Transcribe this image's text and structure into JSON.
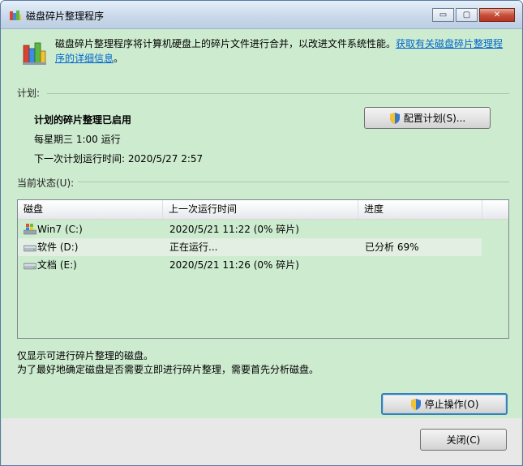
{
  "window": {
    "title": "磁盘碎片整理程序",
    "controls": {
      "minimize": "▭",
      "maximize": "▢",
      "close": "✕"
    }
  },
  "intro": {
    "text": "磁盘碎片整理程序将计算机硬盘上的碎片文件进行合并，以改进文件系统性能。",
    "link": "获取有关磁盘碎片整理程序的详细信息",
    "suffix": "。"
  },
  "schedule": {
    "section_label": "计划:",
    "status": "计划的碎片整理已启用",
    "frequency": "每星期三  1:00 运行",
    "next_run": "下一次计划运行时间: 2020/5/27 2:57",
    "configure_button": "配置计划(S)..."
  },
  "current_status": {
    "section_label": "当前状态(U):",
    "columns": [
      "磁盘",
      "上一次运行时间",
      "进度"
    ],
    "rows": [
      {
        "disk": "Win7 (C:)",
        "last_run": "2020/5/21 11:22 (0% 碎片)",
        "progress": "",
        "icon": "windows-drive-icon"
      },
      {
        "disk": "软件 (D:)",
        "last_run": "正在运行...",
        "progress": "已分析 69%",
        "icon": "hard-drive-icon"
      },
      {
        "disk": "文档 (E:)",
        "last_run": "2020/5/21 11:26 (0% 碎片)",
        "progress": "",
        "icon": "hard-drive-icon"
      }
    ]
  },
  "notes": {
    "line1": "仅显示可进行碎片整理的磁盘。",
    "line2": "为了最好地确定磁盘是否需要立即进行碎片整理，需要首先分析磁盘。"
  },
  "buttons": {
    "stop": "停止操作(O)",
    "close": "关闭(C)"
  },
  "colors": {
    "background": "#cde9cf",
    "link": "#0066cc",
    "selected_row": "#e2efe2"
  }
}
